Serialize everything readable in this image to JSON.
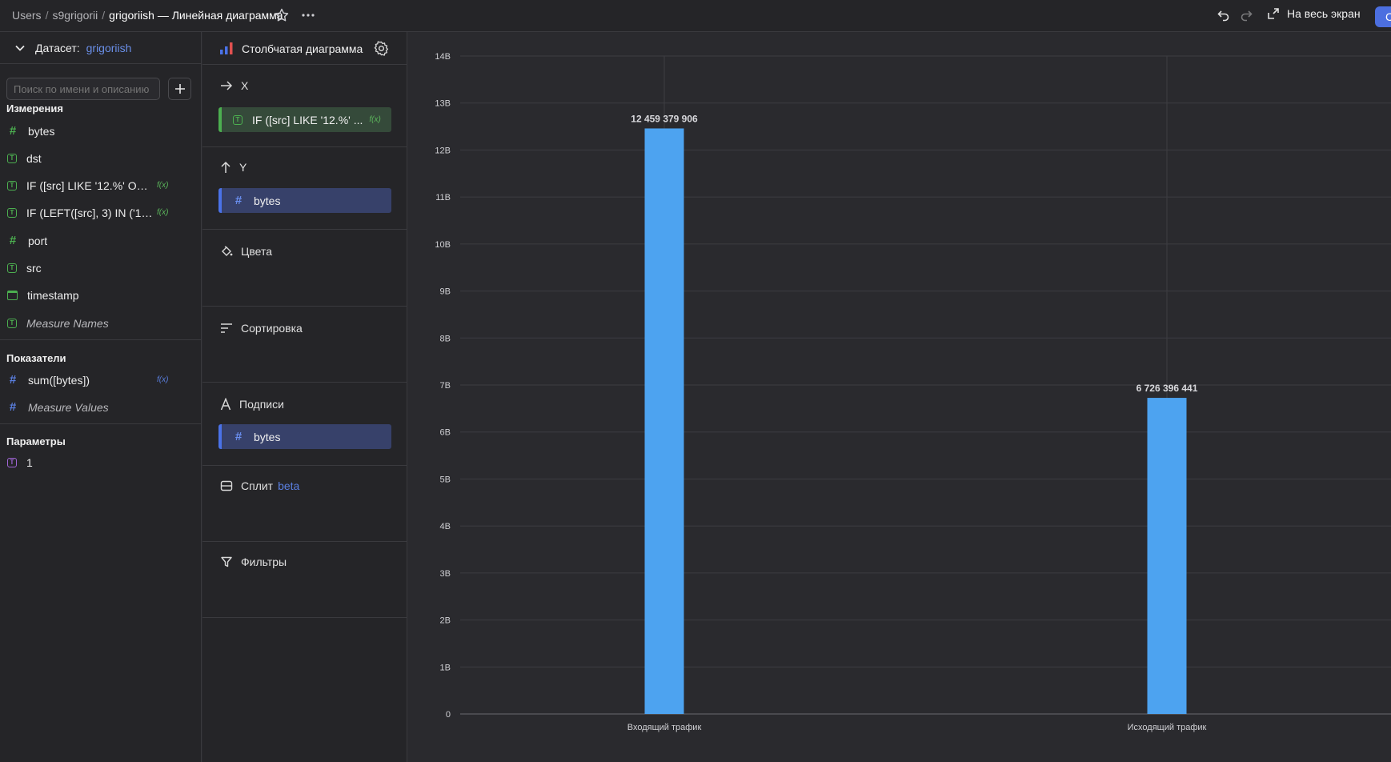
{
  "breadcrumbs": {
    "users": "Users",
    "user": "s9grigorii",
    "current": "grigoriish — Линейная диаграмма"
  },
  "header": {
    "fullscreen_label": "На весь экран",
    "save_label": "С"
  },
  "dataset": {
    "label": "Датасет:",
    "name": "grigoriish"
  },
  "search": {
    "placeholder": "Поиск по имени и описанию"
  },
  "dimensions": {
    "title": "Измерения",
    "items": [
      {
        "name": "bytes",
        "icon": "hash-icon"
      },
      {
        "name": "dst",
        "icon": "text-type-icon"
      },
      {
        "name": "IF ([src] LIKE '12.%' OR [...",
        "icon": "text-type-icon",
        "formula": "f(x)"
      },
      {
        "name": "IF (LEFT([src], 3) IN ('12...",
        "icon": "text-type-icon",
        "formula": "f(x)"
      },
      {
        "name": "port",
        "icon": "hash-icon"
      },
      {
        "name": "src",
        "icon": "text-type-icon"
      },
      {
        "name": "timestamp",
        "icon": "calendar-icon"
      },
      {
        "name": "Measure Names",
        "icon": "text-type-icon"
      }
    ]
  },
  "measures": {
    "title": "Показатели",
    "items": [
      {
        "name": "sum([bytes])",
        "icon": "hash-icon",
        "formula": "f(x)"
      },
      {
        "name": "Measure Values",
        "icon": "hash-icon"
      }
    ]
  },
  "parameters": {
    "title": "Параметры",
    "items": [
      {
        "name": "1",
        "icon": "text-type-icon"
      }
    ]
  },
  "visualization": {
    "title": "Столбчатая диаграмма",
    "sections": {
      "x": {
        "label": "X",
        "chip": "IF ([src] LIKE '12.%' ...",
        "chip_formula": "f(x)"
      },
      "y": {
        "label": "Y",
        "chip": "bytes"
      },
      "colors": {
        "label": "Цвета"
      },
      "sort": {
        "label": "Сортировка"
      },
      "labels": {
        "label": "Подписи",
        "chip": "bytes"
      },
      "split": {
        "label": "Сплит",
        "badge": "beta"
      },
      "filters": {
        "label": "Фильтры"
      }
    }
  },
  "colors": {
    "bar": "#4da3f0",
    "accent": "#4c6fe0",
    "formula": "#5cb85c"
  },
  "chart_data": {
    "type": "bar",
    "categories": [
      "Входящий трафик",
      "Исходящий трафик"
    ],
    "values": [
      12459379906,
      6726396441
    ],
    "data_labels": [
      "12 459 379 906",
      "6 726 396 441"
    ],
    "yticks": [
      "0",
      "1B",
      "2B",
      "3B",
      "4B",
      "5B",
      "6B",
      "7B",
      "8B",
      "9B",
      "10B",
      "11B",
      "12B",
      "13B",
      "14B"
    ],
    "ylim": [
      0,
      14000000000
    ],
    "grid": true
  }
}
